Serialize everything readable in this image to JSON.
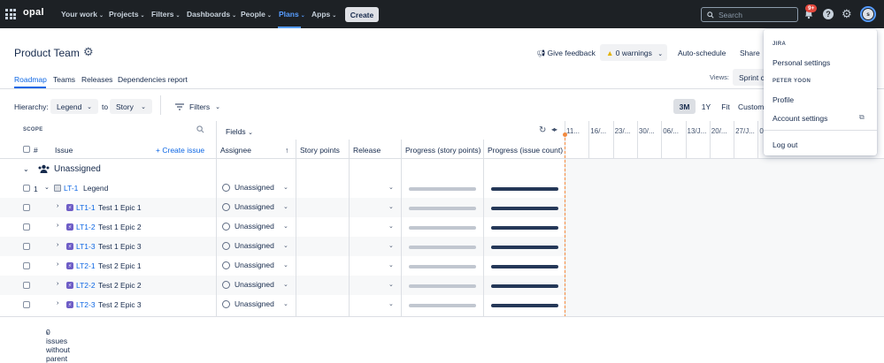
{
  "topnav": {
    "logo": "opal",
    "items": [
      {
        "label": "Your work",
        "chev": "⌄"
      },
      {
        "label": "Projects",
        "chev": "⌄"
      },
      {
        "label": "Filters",
        "chev": "⌄"
      },
      {
        "label": "Dashboards",
        "chev": "⌄"
      },
      {
        "label": "People",
        "chev": "⌄"
      },
      {
        "label": "Plans",
        "chev": "⌄"
      },
      {
        "label": "Apps",
        "chev": "⌄"
      }
    ],
    "create_label": "Create",
    "search_placeholder": "Search",
    "notifications_badge": "9+",
    "avatar_initial": "s"
  },
  "header": {
    "title": "Product Team",
    "give_feedback": "Give feedback",
    "warnings": "0 warnings",
    "auto_schedule": "Auto-schedule",
    "share": "Share"
  },
  "tabs": [
    "Roadmap",
    "Teams",
    "Releases",
    "Dependencies report"
  ],
  "views": {
    "label": "Views:",
    "selected": "Sprint c"
  },
  "toolbar": {
    "hierarchy_label": "Hierarchy:",
    "hierarchy_from": "Legend",
    "to_label": "to",
    "hierarchy_to": "Story",
    "filters": "Filters",
    "ranges": [
      "3M",
      "1Y",
      "Fit",
      "Custom"
    ],
    "active_range": "3M"
  },
  "table": {
    "scope_label": "SCOPE",
    "fields_label": "Fields",
    "columns": {
      "num": "#",
      "issue": "Issue",
      "create_issue": "Create issue",
      "assignee": "Assignee",
      "story_points": "Story points",
      "release": "Release",
      "progress_sp": "Progress (story points)",
      "progress_ic": "Progress (issue count)"
    },
    "group_label": "Unassigned",
    "rows": [
      {
        "num": "1",
        "key": "LT-1",
        "summary": "Legend",
        "assignee": "Unassigned",
        "type": "legend",
        "progress_sp": 0,
        "progress_ic": 1
      },
      {
        "num": "",
        "key": "LT1-1",
        "summary": "Test 1 Epic 1",
        "assignee": "Unassigned",
        "type": "epic",
        "progress_sp": 0,
        "progress_ic": 1
      },
      {
        "num": "",
        "key": "LT1-2",
        "summary": "Test 1 Epic 2",
        "assignee": "Unassigned",
        "type": "epic",
        "progress_sp": 0,
        "progress_ic": 1
      },
      {
        "num": "",
        "key": "LT1-3",
        "summary": "Test 1 Epic 3",
        "assignee": "Unassigned",
        "type": "epic",
        "progress_sp": 0,
        "progress_ic": 1
      },
      {
        "num": "",
        "key": "LT2-1",
        "summary": "Test 2 Epic 1",
        "assignee": "Unassigned",
        "type": "epic",
        "progress_sp": 0,
        "progress_ic": 1
      },
      {
        "num": "",
        "key": "LT2-2",
        "summary": "Test 2 Epic 2",
        "assignee": "Unassigned",
        "type": "epic",
        "progress_sp": 0,
        "progress_ic": 1
      },
      {
        "num": "",
        "key": "LT2-3",
        "summary": "Test 2 Epic 3",
        "assignee": "Unassigned",
        "type": "epic",
        "progress_sp": 0,
        "progress_ic": 1
      }
    ],
    "footer": "0 issues without parent"
  },
  "timeline": {
    "dates": [
      "11...",
      "16/...",
      "23/...",
      "30/...",
      "06/...",
      "13/J...",
      "20/...",
      "27/J...",
      "04/..."
    ]
  },
  "dropdown": {
    "section1": "JIRA",
    "personal_settings": "Personal settings",
    "section2": "PETER YOON",
    "profile": "Profile",
    "account_settings": "Account settings",
    "log_out": "Log out"
  },
  "colors": {
    "nav_bg": "#1d2125",
    "link_blue": "#0c66e4",
    "epic_purple": "#6e5dc6",
    "today_orange": "#f38a3f",
    "progress_done": "#253858",
    "progress_todo": "#c1c7d0"
  }
}
